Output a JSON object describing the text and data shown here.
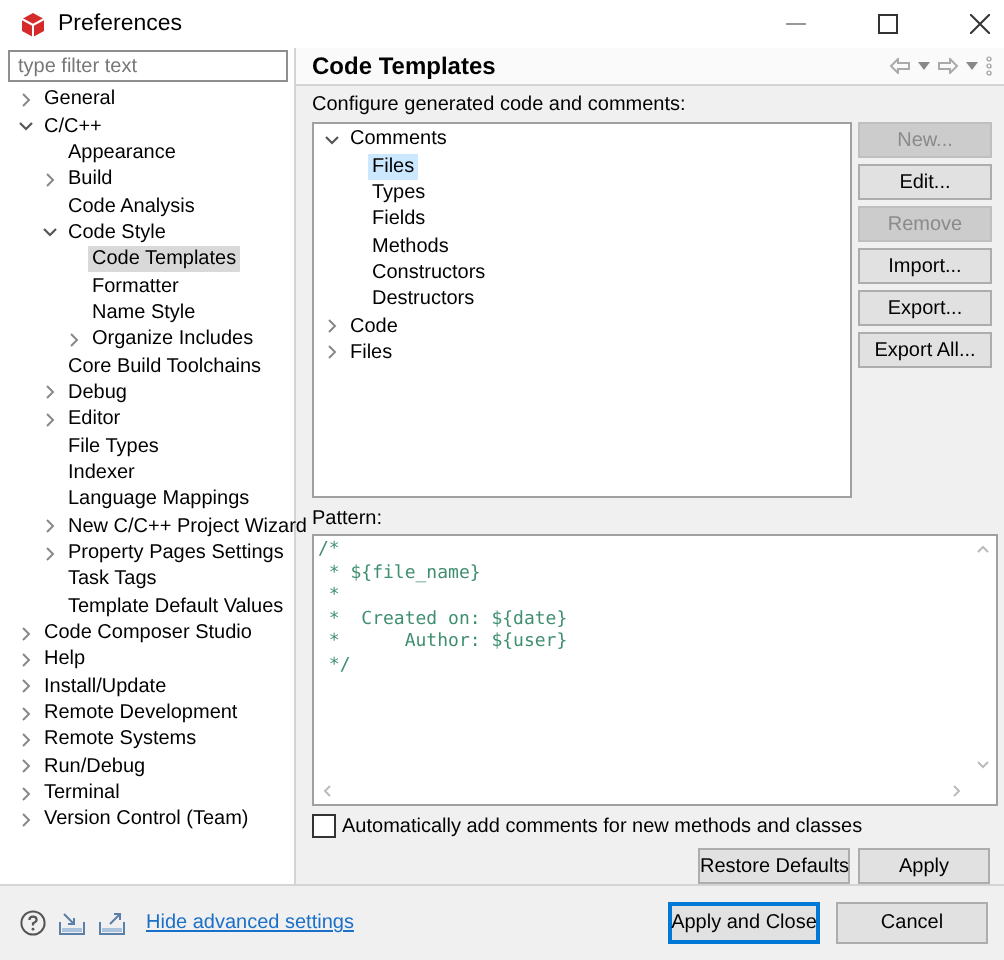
{
  "window": {
    "title": "Preferences"
  },
  "filter": {
    "placeholder": "type filter text"
  },
  "nav_tree": [
    {
      "label": "General",
      "expanded": false,
      "selected": false
    },
    {
      "label": "C/C++",
      "expanded": true,
      "selected": false,
      "children": [
        {
          "label": "Appearance",
          "selected": false
        },
        {
          "label": "Build",
          "expanded": false,
          "selected": false
        },
        {
          "label": "Code Analysis",
          "selected": false
        },
        {
          "label": "Code Style",
          "expanded": true,
          "selected": false,
          "children": [
            {
              "label": "Code Templates",
              "selected": true
            },
            {
              "label": "Formatter",
              "selected": false
            },
            {
              "label": "Name Style",
              "selected": false
            },
            {
              "label": "Organize Includes",
              "expanded": false,
              "selected": false
            }
          ]
        },
        {
          "label": "Core Build Toolchains",
          "selected": false
        },
        {
          "label": "Debug",
          "expanded": false,
          "selected": false
        },
        {
          "label": "Editor",
          "expanded": false,
          "selected": false
        },
        {
          "label": "File Types",
          "selected": false
        },
        {
          "label": "Indexer",
          "selected": false
        },
        {
          "label": "Language Mappings",
          "selected": false
        },
        {
          "label": "New C/C++ Project Wizard",
          "expanded": false,
          "selected": false
        },
        {
          "label": "Property Pages Settings",
          "expanded": false,
          "selected": false
        },
        {
          "label": "Task Tags",
          "selected": false
        },
        {
          "label": "Template Default Values",
          "selected": false
        }
      ]
    },
    {
      "label": "Code Composer Studio",
      "expanded": false,
      "selected": false
    },
    {
      "label": "Help",
      "expanded": false,
      "selected": false
    },
    {
      "label": "Install/Update",
      "expanded": false,
      "selected": false
    },
    {
      "label": "Remote Development",
      "expanded": false,
      "selected": false
    },
    {
      "label": "Remote Systems",
      "expanded": false,
      "selected": false
    },
    {
      "label": "Run/Debug",
      "expanded": false,
      "selected": false
    },
    {
      "label": "Terminal",
      "expanded": false,
      "selected": false
    },
    {
      "label": "Version Control (Team)",
      "expanded": false,
      "selected": false
    }
  ],
  "page": {
    "title": "Code Templates",
    "description": "Configure generated code and comments:",
    "template_tree": [
      {
        "label": "Comments",
        "expanded": true,
        "selected": false,
        "children": [
          {
            "label": "Files",
            "selected": true
          },
          {
            "label": "Types",
            "selected": false
          },
          {
            "label": "Fields",
            "selected": false
          },
          {
            "label": "Methods",
            "selected": false
          },
          {
            "label": "Constructors",
            "selected": false
          },
          {
            "label": "Destructors",
            "selected": false
          }
        ]
      },
      {
        "label": "Code",
        "expanded": false,
        "selected": false
      },
      {
        "label": "Files",
        "expanded": false,
        "selected": false
      }
    ],
    "side_buttons": [
      {
        "label": "New...",
        "disabled": true
      },
      {
        "label": "Edit...",
        "disabled": false
      },
      {
        "label": "Remove",
        "disabled": true
      },
      {
        "label": "Import...",
        "disabled": false
      },
      {
        "label": "Export...",
        "disabled": false
      },
      {
        "label": "Export All...",
        "disabled": false
      }
    ],
    "pattern": {
      "label": "Pattern:",
      "lines": [
        "/*",
        " * ${file_name}",
        " *",
        " *  Created on: ${date}",
        " *      Author: ${user}",
        " */"
      ]
    },
    "auto_comment": {
      "label": "Automatically add comments for new methods and classes",
      "checked": false
    },
    "buttons": [
      {
        "label": "Restore Defaults"
      },
      {
        "label": "Apply"
      }
    ]
  },
  "footer": {
    "link": "Hide advanced settings",
    "buttons": [
      {
        "label": "Apply and Close",
        "default": true
      },
      {
        "label": "Cancel",
        "default": false
      }
    ]
  }
}
